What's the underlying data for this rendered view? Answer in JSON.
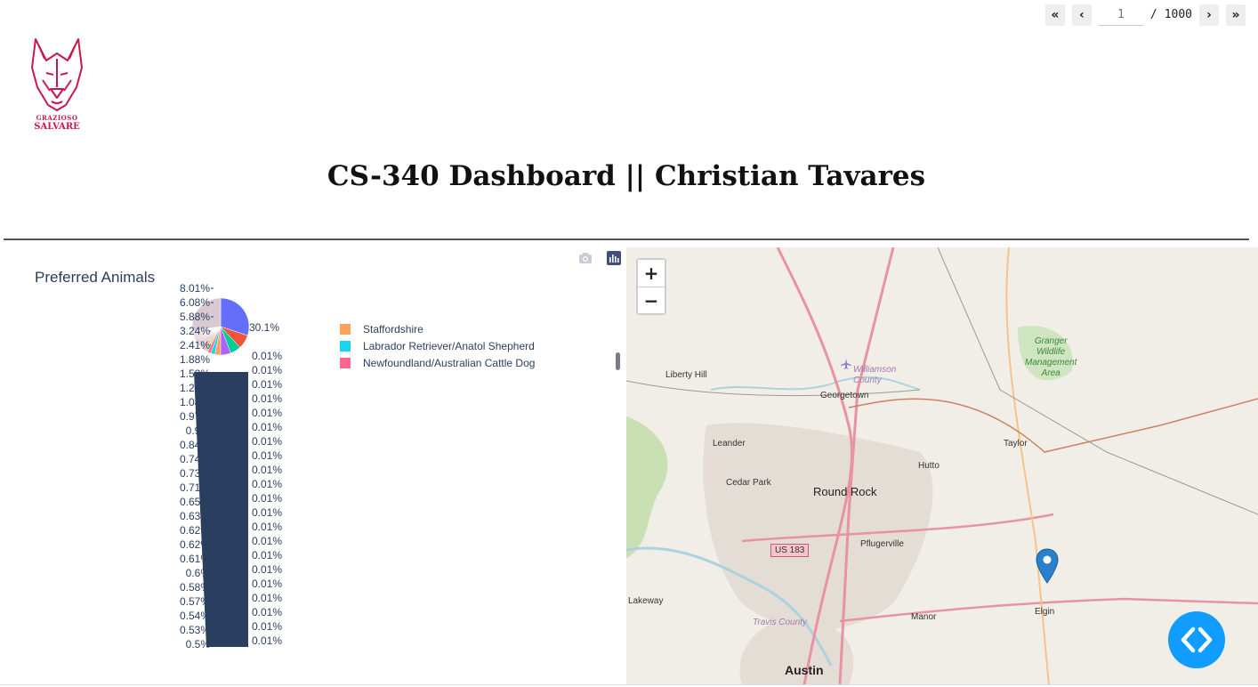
{
  "pagination": {
    "first_label": "«",
    "prev_label": "‹",
    "current_page": "1",
    "separator": "/",
    "total_pages": "1000",
    "next_label": "›",
    "last_label": "»"
  },
  "logo": {
    "icon": "dog-head-logo",
    "line1": "GRAZIOSO",
    "line2": "SALVARE",
    "color": "#c8184a"
  },
  "header": {
    "title": "CS-340 Dashboard || Christian Tavares"
  },
  "chart_data": {
    "type": "pie",
    "title": "Preferred Animals",
    "legend_position": "right",
    "legend": [
      {
        "label": "Staffordshire",
        "color": "#ffa15a"
      },
      {
        "label": "Labrador Retriever/Anatol Shepherd",
        "color": "#19d3f3"
      },
      {
        "label": "Newfoundland/Australian Cattle Dog",
        "color": "#ff6692"
      }
    ],
    "slice_colors": [
      "#636efa",
      "#ef553b",
      "#00cc96",
      "#ab63fa",
      "#ffa15a",
      "#19d3f3",
      "#ff6692",
      "#b6e880",
      "#ff97ff",
      "#fecb52"
    ],
    "tail_color": "#2a3f5f",
    "label_top": "30.1%",
    "labels_left": [
      "8.01%",
      "6.08%",
      "5.88%",
      "3.24%",
      "2.41%",
      "1.88%",
      "1.52%",
      "1.23%",
      "1.08%",
      "0.97%",
      "0.9%",
      "0.84%",
      "0.74%",
      "0.73%",
      "0.71%",
      "0.65%",
      "0.63%",
      "0.62%",
      "0.62%",
      "0.61%",
      "0.6%",
      "0.58%",
      "0.57%",
      "0.54%",
      "0.53%",
      "0.5%"
    ],
    "labels_right": [
      "0.01%",
      "0.01%",
      "0.01%",
      "0.01%",
      "0.01%",
      "0.01%",
      "0.01%",
      "0.01%",
      "0.01%",
      "0.01%",
      "0.01%",
      "0.01%",
      "0.01%",
      "0.01%",
      "0.01%",
      "0.01%",
      "0.01%",
      "0.01%",
      "0.01%",
      "0.01%",
      "0.01%"
    ],
    "values": [
      30.1,
      8.01,
      6.08,
      5.88,
      3.24,
      2.41,
      1.88,
      1.52,
      1.23,
      1.08,
      0.97,
      0.9,
      0.84,
      0.74,
      0.73,
      0.71,
      0.65,
      0.63,
      0.62,
      0.62,
      0.61,
      0.6,
      0.58,
      0.57,
      0.54,
      0.53,
      0.5
    ]
  },
  "modebar": {
    "camera_icon": "camera-icon",
    "plotly_icon": "plotly-logo-icon"
  },
  "map": {
    "zoom_in": "+",
    "zoom_out": "−",
    "marker_color": "#2a81cb",
    "places": {
      "liberty_hill": "Liberty Hill",
      "williamson_county": "Williamson\nCounty",
      "georgetown": "Georgetown",
      "granger": "Granger\nWildlife\nManagement\nArea",
      "leander": "Leander",
      "taylor": "Taylor",
      "hutto": "Hutto",
      "cedar_park": "Cedar Park",
      "round_rock": "Round Rock",
      "us183": "US 183",
      "pflugerville": "Pflugerville",
      "lakeway": "Lakeway",
      "manor": "Manor",
      "elgin": "Elgin",
      "travis_county": "Travis County",
      "austin": "Austin"
    }
  },
  "fab": {
    "icon": "code-brackets-icon",
    "color": "#119dff"
  }
}
